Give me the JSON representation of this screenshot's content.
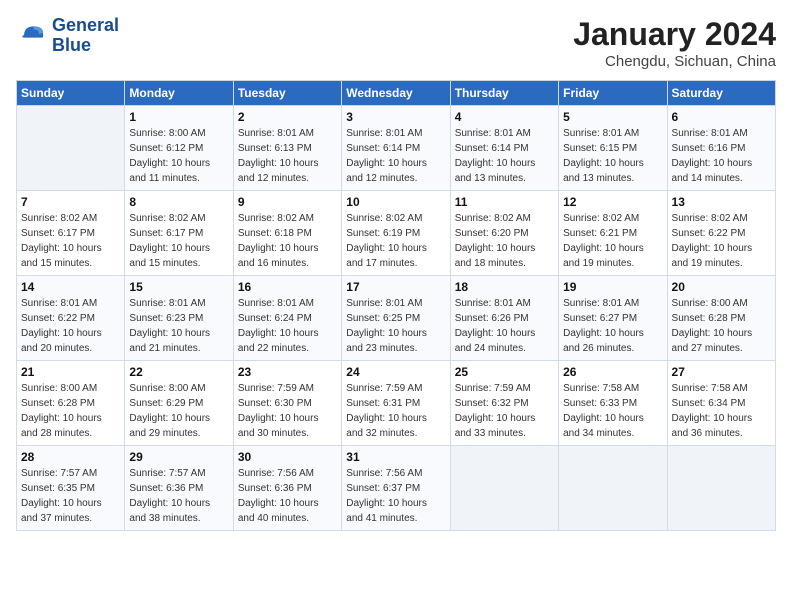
{
  "logo": {
    "line1": "General",
    "line2": "Blue"
  },
  "title": "January 2024",
  "location": "Chengdu, Sichuan, China",
  "days_of_week": [
    "Sunday",
    "Monday",
    "Tuesday",
    "Wednesday",
    "Thursday",
    "Friday",
    "Saturday"
  ],
  "weeks": [
    [
      {
        "day": "",
        "info": ""
      },
      {
        "day": "1",
        "info": "Sunrise: 8:00 AM\nSunset: 6:12 PM\nDaylight: 10 hours\nand 11 minutes."
      },
      {
        "day": "2",
        "info": "Sunrise: 8:01 AM\nSunset: 6:13 PM\nDaylight: 10 hours\nand 12 minutes."
      },
      {
        "day": "3",
        "info": "Sunrise: 8:01 AM\nSunset: 6:14 PM\nDaylight: 10 hours\nand 12 minutes."
      },
      {
        "day": "4",
        "info": "Sunrise: 8:01 AM\nSunset: 6:14 PM\nDaylight: 10 hours\nand 13 minutes."
      },
      {
        "day": "5",
        "info": "Sunrise: 8:01 AM\nSunset: 6:15 PM\nDaylight: 10 hours\nand 13 minutes."
      },
      {
        "day": "6",
        "info": "Sunrise: 8:01 AM\nSunset: 6:16 PM\nDaylight: 10 hours\nand 14 minutes."
      }
    ],
    [
      {
        "day": "7",
        "info": "Sunrise: 8:02 AM\nSunset: 6:17 PM\nDaylight: 10 hours\nand 15 minutes."
      },
      {
        "day": "8",
        "info": "Sunrise: 8:02 AM\nSunset: 6:17 PM\nDaylight: 10 hours\nand 15 minutes."
      },
      {
        "day": "9",
        "info": "Sunrise: 8:02 AM\nSunset: 6:18 PM\nDaylight: 10 hours\nand 16 minutes."
      },
      {
        "day": "10",
        "info": "Sunrise: 8:02 AM\nSunset: 6:19 PM\nDaylight: 10 hours\nand 17 minutes."
      },
      {
        "day": "11",
        "info": "Sunrise: 8:02 AM\nSunset: 6:20 PM\nDaylight: 10 hours\nand 18 minutes."
      },
      {
        "day": "12",
        "info": "Sunrise: 8:02 AM\nSunset: 6:21 PM\nDaylight: 10 hours\nand 19 minutes."
      },
      {
        "day": "13",
        "info": "Sunrise: 8:02 AM\nSunset: 6:22 PM\nDaylight: 10 hours\nand 19 minutes."
      }
    ],
    [
      {
        "day": "14",
        "info": "Sunrise: 8:01 AM\nSunset: 6:22 PM\nDaylight: 10 hours\nand 20 minutes."
      },
      {
        "day": "15",
        "info": "Sunrise: 8:01 AM\nSunset: 6:23 PM\nDaylight: 10 hours\nand 21 minutes."
      },
      {
        "day": "16",
        "info": "Sunrise: 8:01 AM\nSunset: 6:24 PM\nDaylight: 10 hours\nand 22 minutes."
      },
      {
        "day": "17",
        "info": "Sunrise: 8:01 AM\nSunset: 6:25 PM\nDaylight: 10 hours\nand 23 minutes."
      },
      {
        "day": "18",
        "info": "Sunrise: 8:01 AM\nSunset: 6:26 PM\nDaylight: 10 hours\nand 24 minutes."
      },
      {
        "day": "19",
        "info": "Sunrise: 8:01 AM\nSunset: 6:27 PM\nDaylight: 10 hours\nand 26 minutes."
      },
      {
        "day": "20",
        "info": "Sunrise: 8:00 AM\nSunset: 6:28 PM\nDaylight: 10 hours\nand 27 minutes."
      }
    ],
    [
      {
        "day": "21",
        "info": "Sunrise: 8:00 AM\nSunset: 6:28 PM\nDaylight: 10 hours\nand 28 minutes."
      },
      {
        "day": "22",
        "info": "Sunrise: 8:00 AM\nSunset: 6:29 PM\nDaylight: 10 hours\nand 29 minutes."
      },
      {
        "day": "23",
        "info": "Sunrise: 7:59 AM\nSunset: 6:30 PM\nDaylight: 10 hours\nand 30 minutes."
      },
      {
        "day": "24",
        "info": "Sunrise: 7:59 AM\nSunset: 6:31 PM\nDaylight: 10 hours\nand 32 minutes."
      },
      {
        "day": "25",
        "info": "Sunrise: 7:59 AM\nSunset: 6:32 PM\nDaylight: 10 hours\nand 33 minutes."
      },
      {
        "day": "26",
        "info": "Sunrise: 7:58 AM\nSunset: 6:33 PM\nDaylight: 10 hours\nand 34 minutes."
      },
      {
        "day": "27",
        "info": "Sunrise: 7:58 AM\nSunset: 6:34 PM\nDaylight: 10 hours\nand 36 minutes."
      }
    ],
    [
      {
        "day": "28",
        "info": "Sunrise: 7:57 AM\nSunset: 6:35 PM\nDaylight: 10 hours\nand 37 minutes."
      },
      {
        "day": "29",
        "info": "Sunrise: 7:57 AM\nSunset: 6:36 PM\nDaylight: 10 hours\nand 38 minutes."
      },
      {
        "day": "30",
        "info": "Sunrise: 7:56 AM\nSunset: 6:36 PM\nDaylight: 10 hours\nand 40 minutes."
      },
      {
        "day": "31",
        "info": "Sunrise: 7:56 AM\nSunset: 6:37 PM\nDaylight: 10 hours\nand 41 minutes."
      },
      {
        "day": "",
        "info": ""
      },
      {
        "day": "",
        "info": ""
      },
      {
        "day": "",
        "info": ""
      }
    ]
  ]
}
